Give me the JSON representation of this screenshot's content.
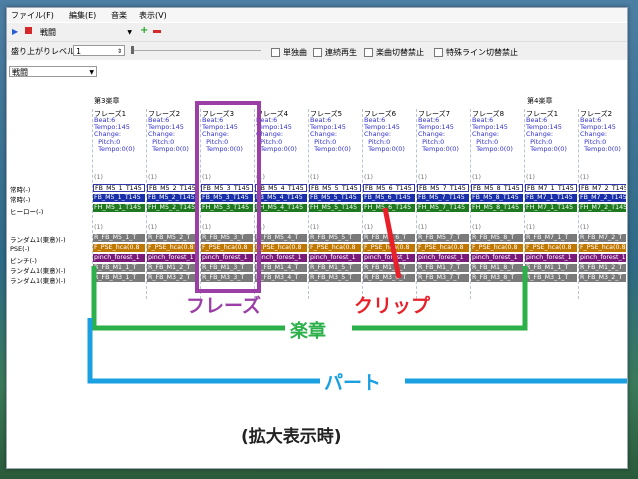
{
  "menu": [
    "ファイル(F)",
    "編集(E)",
    "音楽",
    "表示(V)"
  ],
  "toolbar": {
    "song": "戦闘"
  },
  "controls": {
    "level_label": "盛り上がりレベル",
    "level_value": "1",
    "checkboxes": [
      "単独曲",
      "連続再生",
      "楽曲切替禁止",
      "特殊ライン切替禁止"
    ],
    "view_select": "戦闘"
  },
  "sections": [
    {
      "label": "第3楽章"
    },
    {
      "label": "第4楽章"
    }
  ],
  "phrases": [
    {
      "title": "フレーズ1",
      "info": "Beat:6\nTempo:145\nChange:\n  Pitch:0\n  Tempo:0(0)"
    },
    {
      "title": "フレーズ2",
      "info": "Beat:6\nTempo:145\nChange:\n  Pitch:0\n  Tempo:0(0)"
    },
    {
      "title": "フレーズ3",
      "info": "Beat:6\nTempo:145\nChange:\n  Pitch:0\n  Tempo:0(0)"
    },
    {
      "title": "フレーズ4",
      "info": "Beat:6\nTempo:145\nChange:\n  Pitch:0\n  Tempo:0(0)"
    },
    {
      "title": "フレーズ5",
      "info": "Beat:6\nTempo:145\nChange:\n  Pitch:0\n  Tempo:0(0)"
    },
    {
      "title": "フレーズ6",
      "info": "Beat:6\nTempo:145\nChange:\n  Pitch:0\n  Tempo:0(0)"
    },
    {
      "title": "フレーズ7",
      "info": "Beat:6\nTempo:145\nChange:\n  Pitch:0\n  Tempo:0(0)"
    },
    {
      "title": "フレーズ8",
      "info": "Beat:6\nTempo:145\nChange:\n  Pitch:0\n  Tempo:0(0)"
    },
    {
      "title": "フレーズ1",
      "info": "Beat:6\nTempo:145\nChange:\n  Pitch:0\n  Tempo:0(0)"
    },
    {
      "title": "フレーズ2",
      "info": "Beat:6\nTempo:145\nChange:\n  Pitch:0\n  Tempo:0(0)"
    }
  ],
  "track_labels": [
    "常時(-)",
    "常時(-)",
    "ヒーロー(-)",
    "ランダム1(東意)(-)",
    "PSE(-)",
    "ピンチ(-)",
    "ランダム1(東意)(-)",
    "ランダム1(東意)(-)"
  ],
  "rows": {
    "num": "(1)",
    "blue": [
      "FB_M5_1_T145",
      "FB_M5_2_T145",
      "FB_M5_3_T145",
      "FB_M5_4_T145",
      "FB_M5_5_T145",
      "FB_M5_6_T145",
      "FB_M5_7_T145",
      "FB_M5_8_T145",
      "FB_M7_1_T145",
      "FB_M7_2_T145"
    ],
    "green": [
      "FH_M5_1_T145",
      "FH_M5_2_T145",
      "FH_M5_3_T145",
      "FH_M5_4_T145",
      "FH_M5_5_T145",
      "FH_M5_6_T145",
      "FH_M5_7_T145",
      "FH_M5_8_T145",
      "FH_M7_1_T145",
      "FH_M7_2_T145"
    ],
    "gray1": [
      "R_FB_M5_1_T",
      "R_FB_M5_2_T",
      "R_FB_M5_3_T",
      "R_FB_M5_4_T",
      "R_FB_M5_5_T",
      "R_FB_M5_6_T",
      "R_FB_M5_7_T",
      "R_FB_M5_8_T",
      "R_FB_M7_1_T",
      "R_FB_M7_2_T"
    ],
    "orange": [
      "F_PSE_hca(0.8",
      "F_PSE_hca(0.8",
      "F_PSE_hca(0.8",
      "F_PSE_hca(0.8",
      "F_PSE_hca(0.8",
      "F_PSE_hca(0.8",
      "F_PSE_hca(0.8",
      "F_PSE_hca(0.8",
      "F_PSE_hca(0.8",
      "F_PSE_hca(0.8"
    ],
    "purple": [
      "pinch_forest_1",
      "pinch_forest_1",
      "pinch_forest_1",
      "pinch_forest_1",
      "pinch_forest_1",
      "pinch_forest_1",
      "pinch_forest_1",
      "pinch_forest_1",
      "pinch_forest_1",
      "pinch_forest_1"
    ],
    "gray2": [
      "R_FB_M1_1_T",
      "R_FB_M1_2_T",
      "R_FB_M1_3_T",
      "R_FB_M1_4_T",
      "R_FB_M1_5_T",
      "R_FB_M1_6_T",
      "R_FB_M1_7_T",
      "R_FB_M1_8_T",
      "R_FB_M1_1_T",
      "R_FB_M1_2_T"
    ],
    "gray3": [
      "R_FB_M3_1_T",
      "R_FB_M3_2_T",
      "R_FB_M3_3_T",
      "R_FB_M3_4_T",
      "R_FB_M3_5_T",
      "R_FB_M3_6_T",
      "R_FB_M3_7_T",
      "R_FB_M3_8_T",
      "R_FB_M3_1_T",
      "R_FB_M3_2_T"
    ]
  },
  "annotations": {
    "phrase": "フレーズ",
    "clip": "クリップ",
    "movement": "楽章",
    "part": "パート",
    "zoom": "(拡大表示時)"
  },
  "colors": {
    "purple": "#9b3fa6",
    "red": "#e8202a",
    "green": "#2bb04a",
    "blue": "#1aa0e0"
  }
}
